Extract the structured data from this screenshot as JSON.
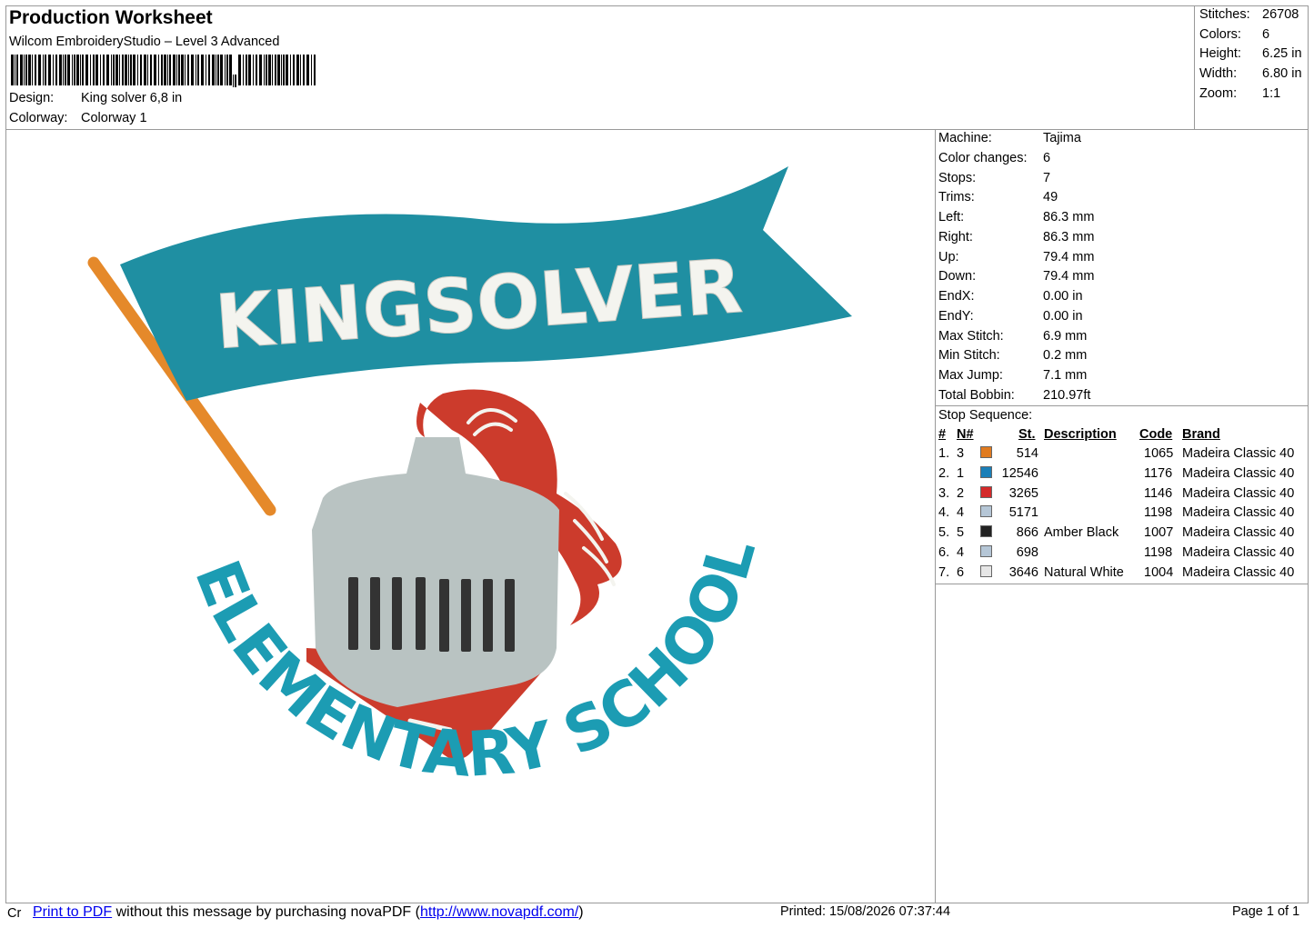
{
  "header": {
    "title": "Production Worksheet",
    "subtitle": "Wilcom EmbroideryStudio – Level 3 Advanced",
    "design_label": "Design:",
    "design_value": "King solver 6,8 in",
    "colorway_label": "Colorway:",
    "colorway_value": "Colorway 1"
  },
  "stats": [
    {
      "label": "Stitches:",
      "value": "26708"
    },
    {
      "label": "Colors:",
      "value": "6"
    },
    {
      "label": "Height:",
      "value": "6.25 in"
    },
    {
      "label": "Width:",
      "value": "6.80 in"
    },
    {
      "label": "Zoom:",
      "value": "1:1"
    }
  ],
  "design": {
    "banner_text": "KINGSOLVER",
    "arc_text": "ELEMENTARY SCHOOL",
    "colors": {
      "banner": "#1f8fa2",
      "pole": "#e5892a",
      "plume": "#cc3b2c",
      "helmet": "#b9c3c2",
      "slot": "#333333",
      "arc_text": "#1c9cb3",
      "white": "#f4f4ef"
    }
  },
  "info": [
    {
      "label": "Machine:",
      "value": "Tajima"
    },
    {
      "label": "Color changes:",
      "value": "6"
    },
    {
      "label": "Stops:",
      "value": "7"
    },
    {
      "label": "Trims:",
      "value": "49"
    },
    {
      "label": "Left:",
      "value": "86.3 mm"
    },
    {
      "label": "Right:",
      "value": "86.3 mm"
    },
    {
      "label": "Up:",
      "value": "79.4 mm"
    },
    {
      "label": "Down:",
      "value": "79.4 mm"
    },
    {
      "label": "EndX:",
      "value": "0.00 in"
    },
    {
      "label": "EndY:",
      "value": "0.00 in"
    },
    {
      "label": "Max Stitch:",
      "value": "6.9 mm"
    },
    {
      "label": "Min Stitch:",
      "value": "0.2 mm"
    },
    {
      "label": "Max Jump:",
      "value": "7.1 mm"
    },
    {
      "label": "Total Bobbin:",
      "value": "210.97ft"
    }
  ],
  "stop_sequence": {
    "title": "Stop Sequence:",
    "headers": {
      "num": "#",
      "n": "N#",
      "st": "St.",
      "desc": "Description",
      "code": "Code",
      "brand": "Brand"
    },
    "rows": [
      {
        "num": "1.",
        "n": "3",
        "color": "#e07b20",
        "st": "514",
        "desc": "",
        "code": "1065",
        "brand": "Madeira Classic 40"
      },
      {
        "num": "2.",
        "n": "1",
        "color": "#1a7fb8",
        "st": "12546",
        "desc": "",
        "code": "1176",
        "brand": "Madeira Classic 40"
      },
      {
        "num": "3.",
        "n": "2",
        "color": "#d42a2a",
        "st": "3265",
        "desc": "",
        "code": "1146",
        "brand": "Madeira Classic 40"
      },
      {
        "num": "4.",
        "n": "4",
        "color": "#b5c6d6",
        "st": "5171",
        "desc": "",
        "code": "1198",
        "brand": "Madeira Classic 40"
      },
      {
        "num": "5.",
        "n": "5",
        "color": "#222222",
        "st": "866",
        "desc": "Amber Black",
        "code": "1007",
        "brand": "Madeira Classic 40"
      },
      {
        "num": "6.",
        "n": "4",
        "color": "#b5c6d6",
        "st": "698",
        "desc": "",
        "code": "1198",
        "brand": "Madeira Classic 40"
      },
      {
        "num": "7.",
        "n": "6",
        "color": "#e6e6e6",
        "st": "3646",
        "desc": "Natural White",
        "code": "1004",
        "brand": "Madeira Classic 40"
      }
    ]
  },
  "footer": {
    "cr": "Cr",
    "print_link": "Print to PDF",
    "message": " without this message by purchasing novaPDF (",
    "url": "http://www.novapdf.com/",
    "close": ")",
    "printed": "Printed: 15/08/2026 07:37:44",
    "page": "Page 1 of 1"
  }
}
